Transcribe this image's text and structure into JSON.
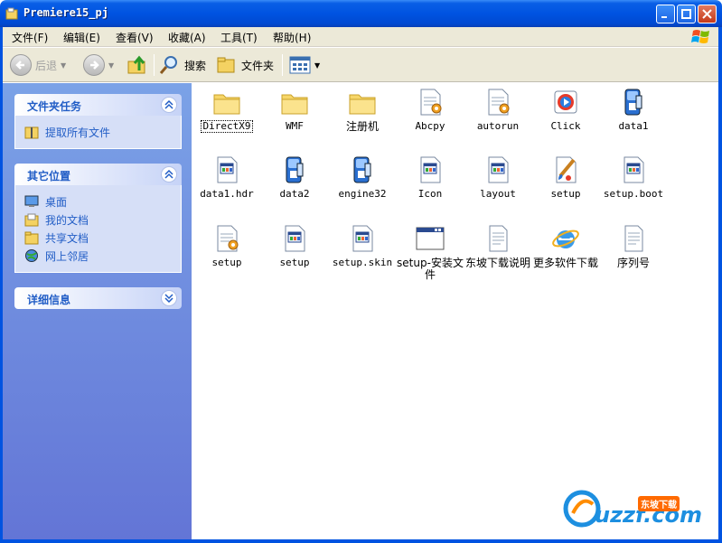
{
  "window": {
    "title": "Premiere15_pj"
  },
  "menubar": {
    "items": [
      "文件(F)",
      "编辑(E)",
      "查看(V)",
      "收藏(A)",
      "工具(T)",
      "帮助(H)"
    ]
  },
  "toolbar": {
    "back_label": "后退",
    "search_label": "搜索",
    "folders_label": "文件夹"
  },
  "leftpane": {
    "folder_tasks": {
      "title": "文件夹任务",
      "links": [
        "提取所有文件"
      ]
    },
    "other_places": {
      "title": "其它位置",
      "links": [
        "桌面",
        "我的文档",
        "共享文档",
        "网上邻居"
      ]
    },
    "details": {
      "title": "详细信息"
    }
  },
  "files": [
    {
      "name": "DirectX9",
      "icon": "folder-icon"
    },
    {
      "name": "WMF",
      "icon": "folder-icon"
    },
    {
      "name": "注册机",
      "icon": "folder-icon"
    },
    {
      "name": "Abcpy",
      "icon": "config-file-icon"
    },
    {
      "name": "autorun",
      "icon": "config-file-icon"
    },
    {
      "name": "Click",
      "icon": "media-file-icon"
    },
    {
      "name": "data1",
      "icon": "installer-data-icon"
    },
    {
      "name": "data1.hdr",
      "icon": "generic-file-icon"
    },
    {
      "name": "data2",
      "icon": "installer-data-icon"
    },
    {
      "name": "engine32",
      "icon": "installer-data-icon"
    },
    {
      "name": "Icon",
      "icon": "generic-file-icon"
    },
    {
      "name": "layout",
      "icon": "generic-file-icon"
    },
    {
      "name": "setup",
      "icon": "paint-brush-icon"
    },
    {
      "name": "setup.boot",
      "icon": "generic-file-icon"
    },
    {
      "name": "setup",
      "icon": "config-file-icon"
    },
    {
      "name": "setup",
      "icon": "generic-file-icon"
    },
    {
      "name": "setup.skin",
      "icon": "generic-file-icon"
    },
    {
      "name": "setup-安装文件",
      "icon": "application-window-icon"
    },
    {
      "name": "东坡下载说明",
      "icon": "text-document-icon"
    },
    {
      "name": "更多软件下载",
      "icon": "internet-explorer-icon"
    },
    {
      "name": "序列号",
      "icon": "text-document-icon"
    }
  ],
  "watermark": {
    "text": "uzzf.com",
    "badge": "东坡下载"
  },
  "colors": {
    "titlebar": "#0053e1",
    "leftpane": "#6f8de0",
    "link": "#215dc6"
  }
}
